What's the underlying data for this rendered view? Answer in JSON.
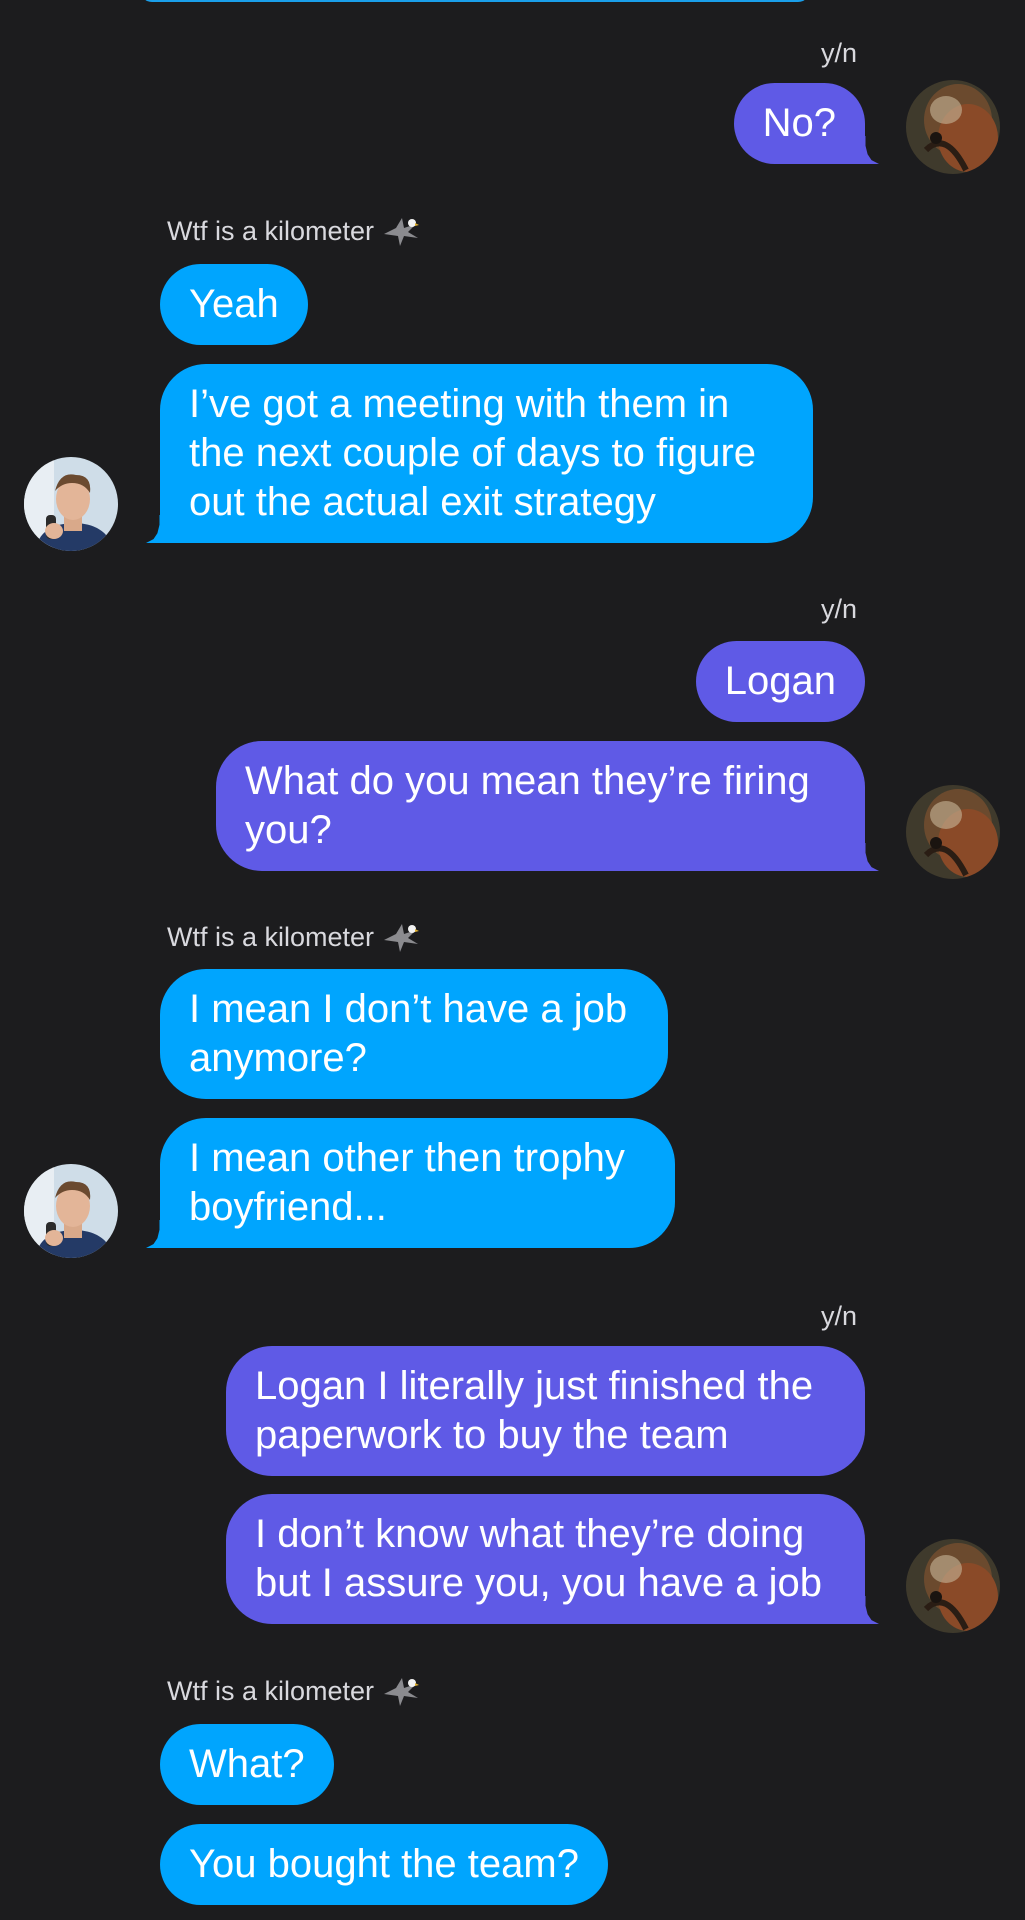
{
  "contacts": {
    "me": "y/n",
    "them": "Wtf is a kilometer",
    "them_emoji_icon": "eagle-icon"
  },
  "colors": {
    "background": "#1c1c1e",
    "my_bubble": "#5f5ae6",
    "their_bubble": "#00a5fe"
  },
  "messages": [
    {
      "sender": "me",
      "text": "No?"
    },
    {
      "sender": "them",
      "text": "Yeah"
    },
    {
      "sender": "them",
      "text": "I’ve got a meeting with them in the next couple of days to figure out the actual exit strategy"
    },
    {
      "sender": "me",
      "text": "Logan"
    },
    {
      "sender": "me",
      "text": "What do you mean they’re firing you?"
    },
    {
      "sender": "them",
      "text": "I mean I don’t have a job anymore?"
    },
    {
      "sender": "them",
      "text": "I mean other then trophy boyfriend..."
    },
    {
      "sender": "me",
      "text": "Logan I literally just finished the paperwork to buy the team"
    },
    {
      "sender": "me",
      "text": "I don’t know what they’re doing but I assure you, you have a job"
    },
    {
      "sender": "them",
      "text": "What?"
    },
    {
      "sender": "them",
      "text": "You bought the team?"
    }
  ]
}
